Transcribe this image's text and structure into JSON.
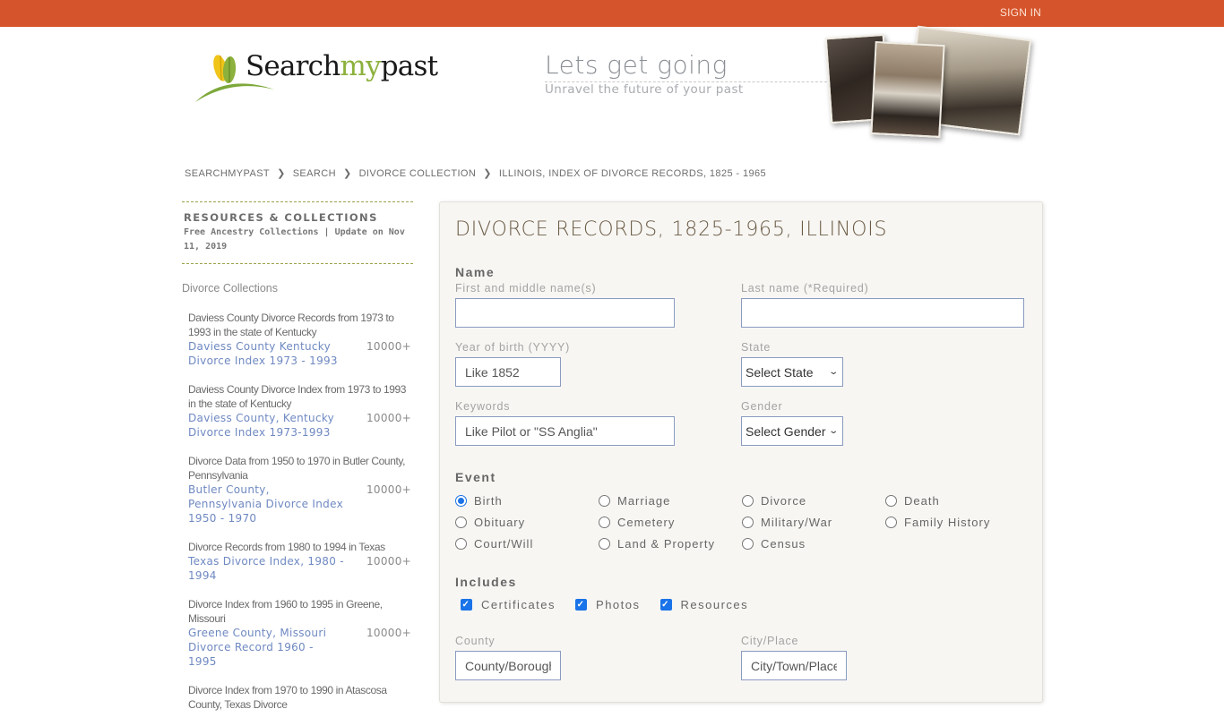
{
  "topbar": {
    "sign_in_label": "SIGN IN",
    "background_color": "#d6542b"
  },
  "logo": {
    "part1": "Search",
    "part2": "my",
    "part3": "past",
    "accent_color": "#8cb13c"
  },
  "tagline": {
    "main": "Lets get going",
    "sub": "Unravel the future of your past"
  },
  "breadcrumb": [
    {
      "label": "SEARCHMYPAST"
    },
    {
      "label": "SEARCH"
    },
    {
      "label": "DIVORCE COLLECTION"
    },
    {
      "label": "ILLINOIS, INDEX OF DIVORCE RECORDS, 1825 - 1965"
    }
  ],
  "breadcrumb_separator": "❯",
  "sidebar": {
    "title": "RESOURCES & COLLECTIONS",
    "subtitle": "Free Ancestry Collections | Update on Nov 11, 2019",
    "section_label": "Divorce Collections",
    "items": [
      {
        "desc": "Daviess County Divorce Records from 1973 to 1993 in the state of Kentucky",
        "link": "Daviess County Kentucky Divorce Index 1973 - 1993",
        "count": "10000+"
      },
      {
        "desc": "Daviess County Divorce Index from 1973 to 1993 in the state of Kentucky",
        "link": "Daviess County, Kentucky Divorce Index 1973-1993",
        "count": "10000+"
      },
      {
        "desc": "Divorce Data from 1950 to 1970 in Butler County, Pennsylvania",
        "link": "Butler County, Pennsylvania Divorce Index 1950 - 1970",
        "count": "10000+"
      },
      {
        "desc": "Divorce Records from 1980 to 1994 in Texas",
        "link": "Texas Divorce Index, 1980 - 1994",
        "count": "10000+"
      },
      {
        "desc": "Divorce Index from 1960 to 1995 in Greene, Missouri",
        "link": "Greene County, Missouri Divorce Record 1960 - 1995",
        "count": "10000+"
      },
      {
        "desc": "Divorce Index from 1970 to 1990 in Atascosa County, Texas Divorce",
        "link": "",
        "count": ""
      }
    ]
  },
  "form": {
    "title": "DIVORCE RECORDS, 1825-1965, ILLINOIS",
    "name_section": "Name",
    "first_name_label": "First and middle name(s)",
    "first_name_value": "",
    "last_name_label": "Last name (*Required)",
    "last_name_value": "",
    "year_label": "Year of birth (YYYY)",
    "year_placeholder": "Like 1852",
    "state_label": "State",
    "state_selected": "Select State",
    "keywords_label": "Keywords",
    "keywords_placeholder": "Like Pilot or \"SS Anglia\"",
    "gender_label": "Gender",
    "gender_selected": "Select Gender",
    "event_section": "Event",
    "events": [
      {
        "label": "Birth",
        "checked": true
      },
      {
        "label": "Marriage",
        "checked": false
      },
      {
        "label": "Divorce",
        "checked": false
      },
      {
        "label": "Death",
        "checked": false
      },
      {
        "label": "Obituary",
        "checked": false
      },
      {
        "label": "Cemetery",
        "checked": false
      },
      {
        "label": "Military/War",
        "checked": false
      },
      {
        "label": "Family History",
        "checked": false
      },
      {
        "label": "Court/Will",
        "checked": false
      },
      {
        "label": "Land & Property",
        "checked": false
      },
      {
        "label": "Census",
        "checked": false
      }
    ],
    "includes_section": "Includes",
    "includes": [
      {
        "label": "Certificates",
        "checked": true
      },
      {
        "label": "Photos",
        "checked": true
      },
      {
        "label": "Resources",
        "checked": true
      }
    ],
    "county_label": "County",
    "county_placeholder": "County/Borough",
    "city_label": "City/Place",
    "city_placeholder": "City/Town/Place"
  }
}
